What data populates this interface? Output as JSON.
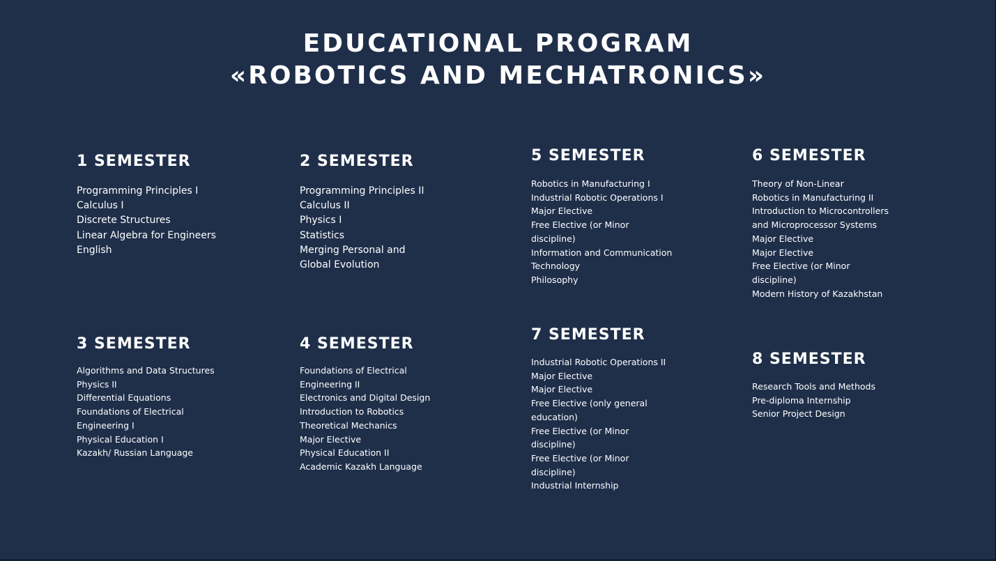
{
  "title": {
    "line1": "EDUCATIONAL PROGRAM",
    "line2": "«ROBOTICS AND MECHATRONICS»"
  },
  "semesters": [
    {
      "heading": "1 SEMESTER",
      "courses": [
        "Programming Principles I",
        "Calculus I",
        "Discrete Structures",
        "Linear Algebra for Engineers",
        "English"
      ]
    },
    {
      "heading": "2 SEMESTER",
      "courses": [
        "Programming Principles II",
        "Calculus II",
        "Physics I",
        "Statistics",
        "Merging Personal and",
        "Global Evolution"
      ]
    },
    {
      "heading": "3 SEMESTER",
      "courses": [
        "Algorithms and Data Structures",
        "Physics II",
        "Differential Equations",
        "Foundations of Electrical Engineering I",
        "Physical Education I",
        "Kazakh/ Russian Language"
      ]
    },
    {
      "heading": "4 SEMESTER",
      "courses": [
        "Foundations of Electrical Engineering II",
        "Electronics and Digital Design",
        "Introduction to Robotics",
        "Theoretical Mechanics",
        "Major Elective",
        "Physical Education II",
        "Academic Kazakh Language"
      ]
    },
    {
      "heading": "5 SEMESTER",
      "courses": [
        "Robotics in Manufacturing I",
        "Industrial Robotic Operations I",
        "Major Elective",
        "Free Elective (or Minor discipline)",
        "Information and Communication Technology",
        "Philosophy"
      ]
    },
    {
      "heading": "6 SEMESTER",
      "courses": [
        "Theory of Non-Linear",
        "Robotics in Manufacturing II",
        "Introduction to Microcontrollers and Microprocessor Systems",
        "Major Elective",
        "Major Elective",
        "Free Elective (or Minor discipline)",
        "Modern History of Kazakhstan"
      ]
    },
    {
      "heading": "7 SEMESTER",
      "courses": [
        "Industrial Robotic Operations II",
        "Major Elective",
        "Major Elective",
        "Free Elective (only general education)",
        "Free Elective (or Minor discipline)",
        "Free Elective (or Minor discipline)",
        "Industrial Internship"
      ]
    },
    {
      "heading": "8 SEMESTER",
      "courses": [
        "Research Tools and Methods",
        "Pre-diploma Internship",
        "Senior Project Design"
      ]
    }
  ]
}
